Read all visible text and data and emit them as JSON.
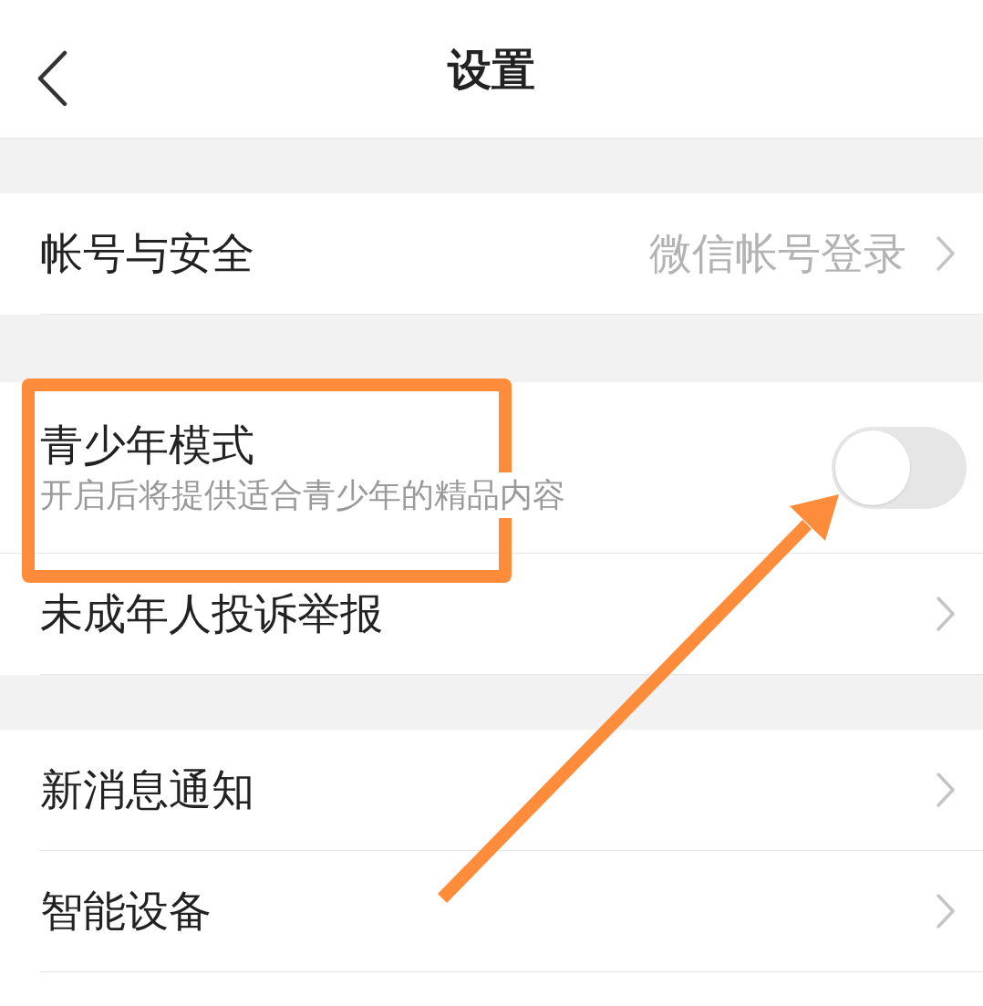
{
  "header": {
    "title": "设置"
  },
  "sections": [
    {
      "items": [
        {
          "kind": "link",
          "label": "帐号与安全",
          "value": "微信帐号登录"
        }
      ]
    },
    {
      "items": [
        {
          "kind": "toggle",
          "label": "青少年模式",
          "description": "开启后将提供适合青少年的精品内容",
          "on": false
        },
        {
          "kind": "link",
          "label": "未成年人投诉举报"
        }
      ]
    },
    {
      "items": [
        {
          "kind": "link",
          "label": "新消息通知"
        },
        {
          "kind": "link",
          "label": "智能设备"
        }
      ]
    }
  ],
  "annotations": {
    "frame": true,
    "arrow": true
  }
}
